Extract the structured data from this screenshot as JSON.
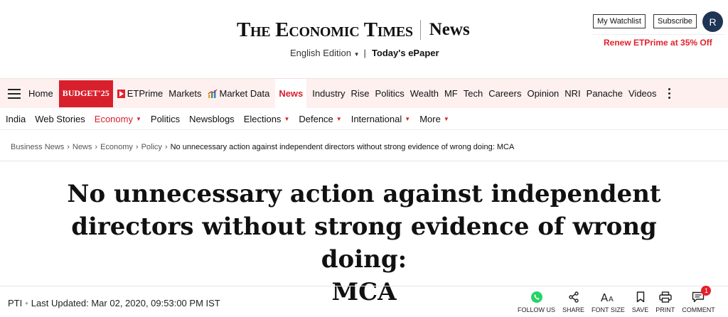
{
  "masthead": {
    "logo_main": "The Economic Times",
    "logo_sub": "News",
    "edition": "English Edition",
    "edition_sep": "|",
    "epaper": "Today's ePaper",
    "watchlist_label": "My Watchlist",
    "subscribe_label": "Subscribe",
    "avatar_initial": "R",
    "renew_label": "Renew ETPrime at 35% Off"
  },
  "nav_primary": {
    "items": [
      {
        "label": "Home"
      },
      {
        "label": "BUDGET'25"
      },
      {
        "label": "ETPrime",
        "icon": "etprime-icon"
      },
      {
        "label": "Markets"
      },
      {
        "label": "Market Data",
        "icon": "market-data-icon"
      },
      {
        "label": "News",
        "active": true
      },
      {
        "label": "Industry"
      },
      {
        "label": "Rise"
      },
      {
        "label": "Politics"
      },
      {
        "label": "Wealth"
      },
      {
        "label": "MF"
      },
      {
        "label": "Tech"
      },
      {
        "label": "Careers"
      },
      {
        "label": "Opinion"
      },
      {
        "label": "NRI"
      },
      {
        "label": "Panache"
      },
      {
        "label": "Videos"
      }
    ]
  },
  "nav_secondary": {
    "items": [
      {
        "label": "India"
      },
      {
        "label": "Web Stories"
      },
      {
        "label": "Economy",
        "active": true,
        "dropdown": true
      },
      {
        "label": "Politics"
      },
      {
        "label": "Newsblogs"
      },
      {
        "label": "Elections",
        "dropdown": true
      },
      {
        "label": "Defence",
        "dropdown": true
      },
      {
        "label": "International",
        "dropdown": true
      },
      {
        "label": "More",
        "dropdown": true
      }
    ]
  },
  "breadcrumb": {
    "items": [
      "Business News",
      "News",
      "Economy",
      "Policy"
    ],
    "separator": "›",
    "current": "No unnecessary action against independent directors without strong evidence of wrong doing: MCA"
  },
  "article": {
    "headline_line1": "No unnecessary action against independent",
    "headline_line2": "directors without strong evidence of wrong doing:",
    "headline_line3": "MCA",
    "source": "PTI",
    "byline_sep": "•",
    "last_updated": "Last Updated: Mar 02, 2020, 09:53:00 PM IST"
  },
  "actions": {
    "follow": "FOLLOW US",
    "share": "SHARE",
    "font_size": "FONT SIZE",
    "save": "SAVE",
    "print": "PRINT",
    "comment": "COMMENT",
    "comment_count": "1"
  },
  "colors": {
    "brand_red": "#d8202d",
    "nav_bg": "#fdf0ef",
    "avatar_bg": "#1f3555",
    "whatsapp_green": "#25d366"
  }
}
